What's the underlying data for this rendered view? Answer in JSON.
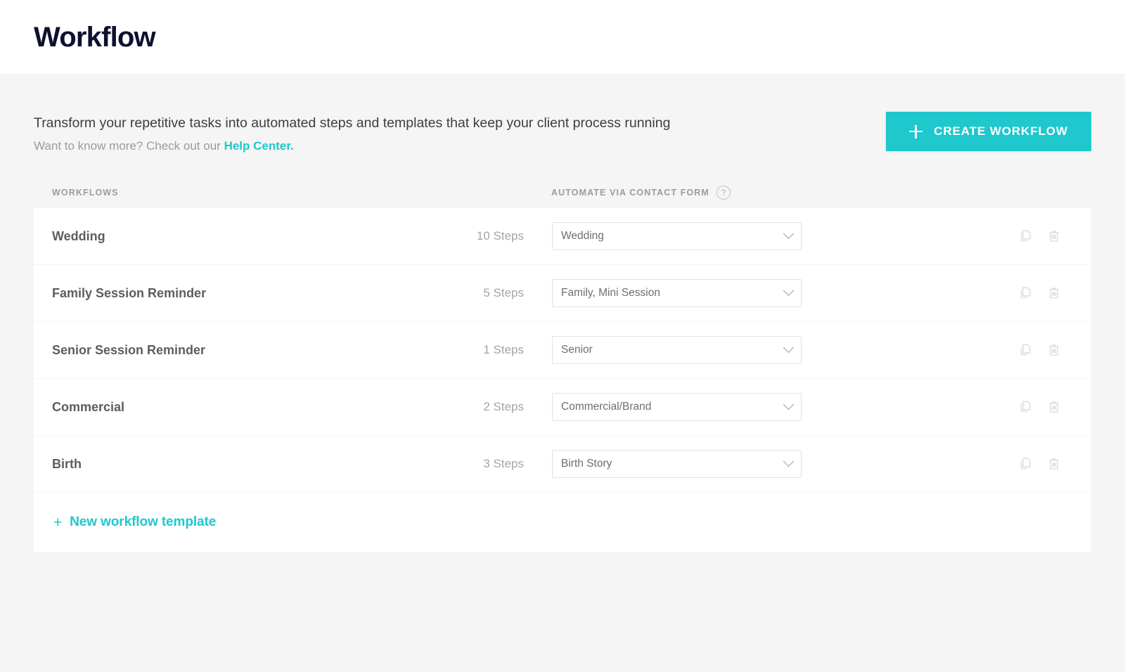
{
  "header": {
    "title": "Workflow"
  },
  "intro": {
    "line1": "Transform your repetitive tasks into automated steps and templates that keep your client process running",
    "line2_prefix": "Want to know more? Check out our ",
    "help_link_label": "Help Center.",
    "create_button_label": "CREATE WORKFLOW",
    "plus_icon": "plus-icon"
  },
  "columns": {
    "workflows_label": "WORKFLOWS",
    "automate_label": "AUTOMATE VIA CONTACT FORM",
    "help_icon_label": "?",
    "help_icon": "question-mark-circle-icon"
  },
  "rows": [
    {
      "name": "Wedding",
      "steps": "10 Steps",
      "contact_form": "Wedding",
      "duplicate_icon": "duplicate-icon",
      "delete_icon": "trash-icon"
    },
    {
      "name": "Family Session Reminder",
      "steps": "5 Steps",
      "contact_form": "Family, Mini Session",
      "duplicate_icon": "duplicate-icon",
      "delete_icon": "trash-icon"
    },
    {
      "name": "Senior Session Reminder",
      "steps": "1 Steps",
      "contact_form": "Senior",
      "duplicate_icon": "duplicate-icon",
      "delete_icon": "trash-icon"
    },
    {
      "name": "Commercial",
      "steps": "2 Steps",
      "contact_form": "Commercial/Brand",
      "duplicate_icon": "duplicate-icon",
      "delete_icon": "trash-icon"
    },
    {
      "name": "Birth",
      "steps": "3 Steps",
      "contact_form": "Birth Story",
      "duplicate_icon": "duplicate-icon",
      "delete_icon": "trash-icon"
    }
  ],
  "footer": {
    "new_template_plus": "+",
    "new_template_label": "New workflow template"
  },
  "colors": {
    "accent_teal": "#1ec8cd",
    "title_navy": "#0d1030",
    "page_background": "#f5f5f5",
    "row_background": "#ffffff",
    "muted_text": "#9b9b9b"
  }
}
